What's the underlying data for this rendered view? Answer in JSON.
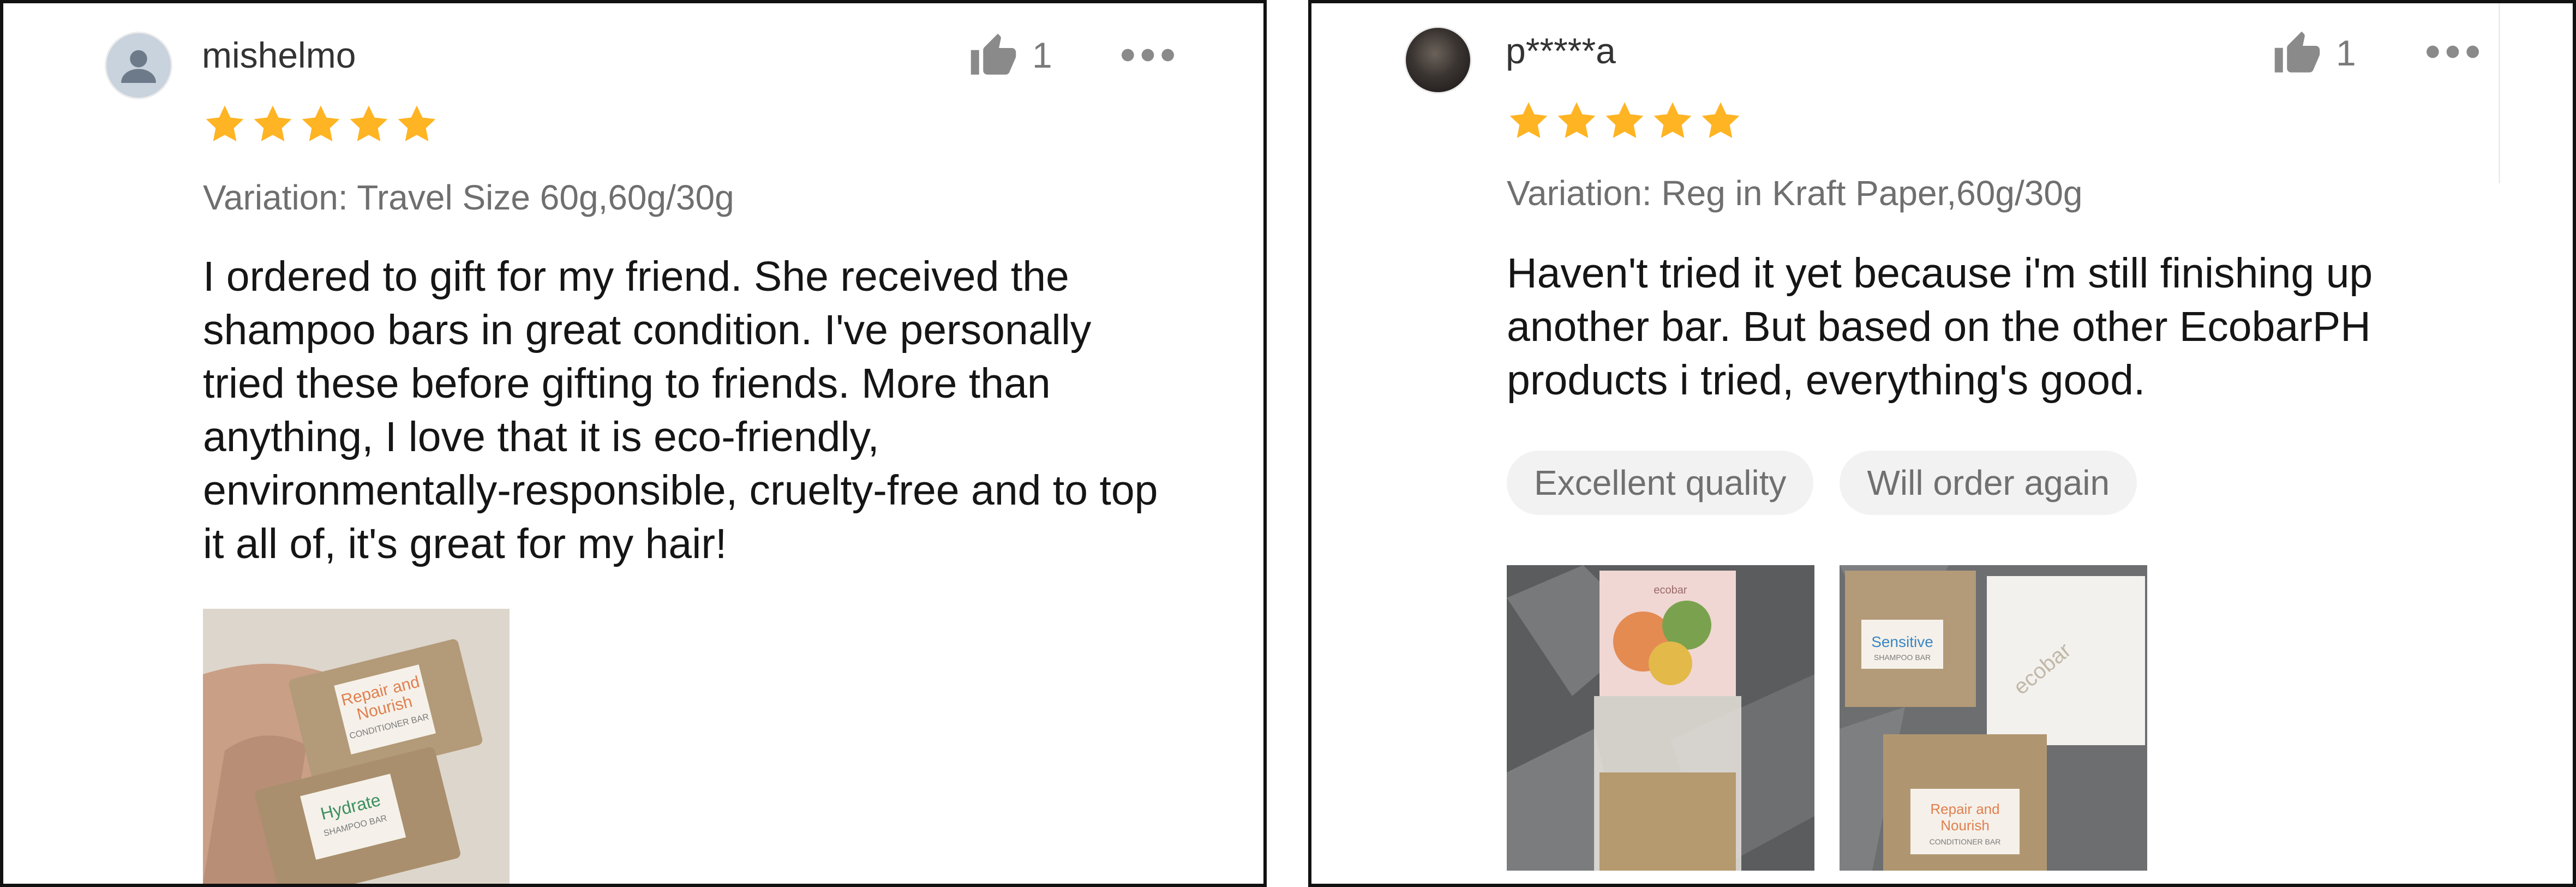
{
  "reviews": [
    {
      "username": "mishelmo",
      "likes": "1",
      "rating": 5,
      "variation": "Variation: Travel Size 60g,60g/30g",
      "text": "I ordered to gift for my friend.  She received the shampoo bars in great condition.  I've personally tried these before gifting to friends. More than anything, I love that it is eco-friendly, environmentally-responsible, cruelty-free and to top it all of, it's great for my hair!",
      "photos": [
        {
          "bar1_line1": "Repair and",
          "bar1_line2": "Nourish",
          "bar1_line3": "CONDITIONER BAR",
          "bar2_line1": "Hydrate",
          "bar2_line2": "SHAMPOO BAR"
        }
      ]
    },
    {
      "username": "p*****a",
      "likes": "1",
      "rating": 5,
      "variation": "Variation: Reg in Kraft Paper,60g/30g",
      "text": "Haven't tried it yet because i'm still finishing up another bar. But based on the other EcobarPH products i tried, everything's good.",
      "tags": [
        "Excellent quality",
        "Will order again"
      ],
      "photos": [
        {
          "label": "ecobar"
        },
        {
          "box1_line1": "Sensitive",
          "box1_line2": "SHAMPOO BAR",
          "brand": "ecobar",
          "box3_line1": "Repair and",
          "box3_line2": "Nourish",
          "box3_line3": "CONDITIONER BAR"
        }
      ]
    }
  ],
  "colors": {
    "star": "#ffb424",
    "text": "#151515",
    "muted": "#6f6f6f",
    "tag_bg": "#f2f2f2",
    "border": "#111111"
  },
  "icons": [
    "user-avatar-icon",
    "thumbs-up-icon",
    "more-options-icon",
    "star-icon"
  ]
}
